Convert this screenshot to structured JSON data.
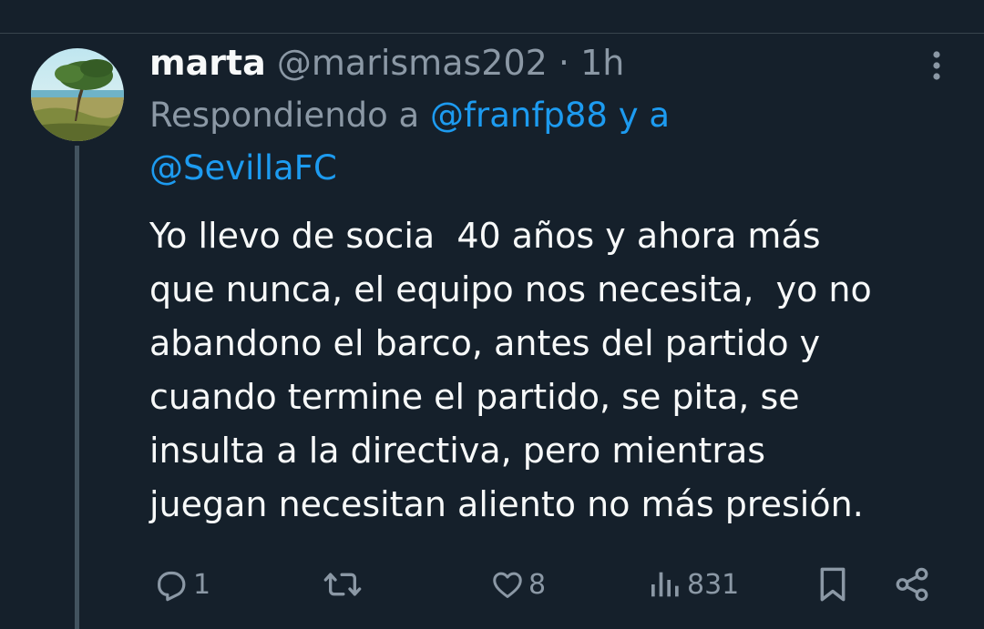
{
  "tweet": {
    "author_name": "marta",
    "handle": "@marismas202",
    "separator": "·",
    "time": "1h",
    "reply_prefix": "Respondiendo a",
    "reply_mention_1": "@franfp88",
    "reply_and": "y a",
    "reply_mention_2": "@SevillaFC",
    "text": "Yo llevo de socia  40 años y ahora más\nque nunca, el equipo nos necesita,  yo no\nabandono el barco, antes del partido y\ncuando termine el partido, se pita, se\ninsulta a la directiva, pero mientras\njuegan necesitan aliento no más presión."
  },
  "actions": {
    "replies": "1",
    "retweets": "",
    "likes": "8",
    "views": "831"
  },
  "colors": {
    "background": "#15202b",
    "text_primary": "#f7f9f9",
    "text_secondary": "#8b98a5",
    "accent": "#1d9bf0",
    "thread_line": "#42535f"
  },
  "icons": [
    "avatar",
    "more-icon",
    "reply-icon",
    "retweet-icon",
    "like-icon",
    "views-icon",
    "bookmark-icon",
    "share-icon"
  ]
}
